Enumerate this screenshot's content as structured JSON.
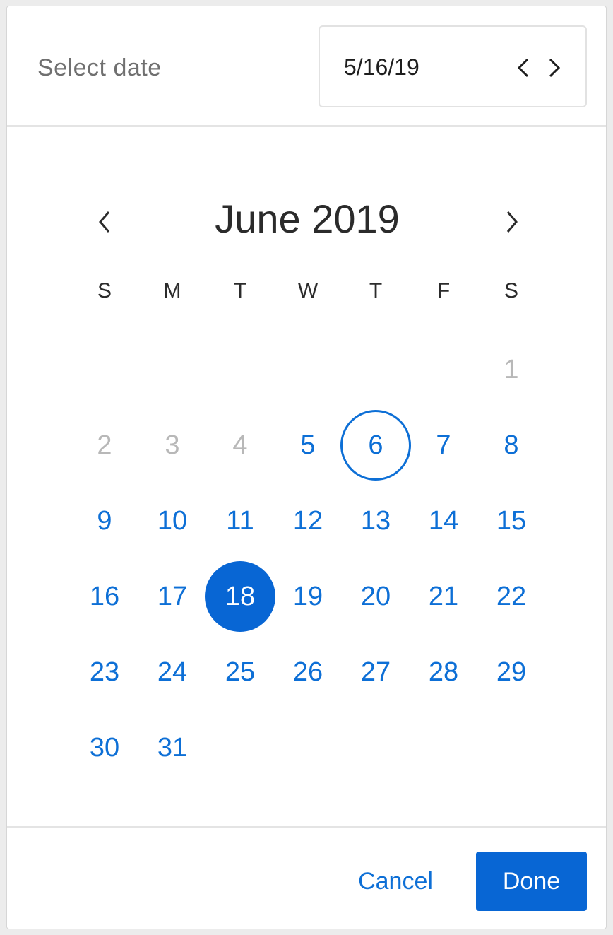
{
  "header": {
    "title": "Select date",
    "date_value": "5/16/19",
    "prev_icon": "chevron-left-icon",
    "next_icon": "chevron-right-icon"
  },
  "calendar": {
    "month_title": "June 2019",
    "weekdays": [
      "S",
      "M",
      "T",
      "W",
      "T",
      "F",
      "S"
    ],
    "first_weekday_index": 6,
    "days": [
      {
        "label": "1",
        "state": "disabled"
      },
      {
        "label": "2",
        "state": "disabled"
      },
      {
        "label": "3",
        "state": "disabled"
      },
      {
        "label": "4",
        "state": "disabled"
      },
      {
        "label": "5",
        "state": "enabled"
      },
      {
        "label": "6",
        "state": "today"
      },
      {
        "label": "7",
        "state": "enabled"
      },
      {
        "label": "8",
        "state": "enabled"
      },
      {
        "label": "9",
        "state": "enabled"
      },
      {
        "label": "10",
        "state": "enabled"
      },
      {
        "label": "11",
        "state": "enabled"
      },
      {
        "label": "12",
        "state": "enabled"
      },
      {
        "label": "13",
        "state": "enabled"
      },
      {
        "label": "14",
        "state": "enabled"
      },
      {
        "label": "15",
        "state": "enabled"
      },
      {
        "label": "16",
        "state": "enabled"
      },
      {
        "label": "17",
        "state": "enabled"
      },
      {
        "label": "18",
        "state": "selected"
      },
      {
        "label": "19",
        "state": "enabled"
      },
      {
        "label": "20",
        "state": "enabled"
      },
      {
        "label": "21",
        "state": "enabled"
      },
      {
        "label": "22",
        "state": "enabled"
      },
      {
        "label": "23",
        "state": "enabled"
      },
      {
        "label": "24",
        "state": "enabled"
      },
      {
        "label": "25",
        "state": "enabled"
      },
      {
        "label": "26",
        "state": "enabled"
      },
      {
        "label": "27",
        "state": "enabled"
      },
      {
        "label": "28",
        "state": "enabled"
      },
      {
        "label": "29",
        "state": "enabled"
      },
      {
        "label": "30",
        "state": "enabled"
      },
      {
        "label": "31",
        "state": "enabled"
      }
    ]
  },
  "footer": {
    "cancel_label": "Cancel",
    "done_label": "Done"
  },
  "colors": {
    "accent": "#0866d4",
    "link": "#0d6fd6",
    "disabled": "#b8b8b8"
  }
}
